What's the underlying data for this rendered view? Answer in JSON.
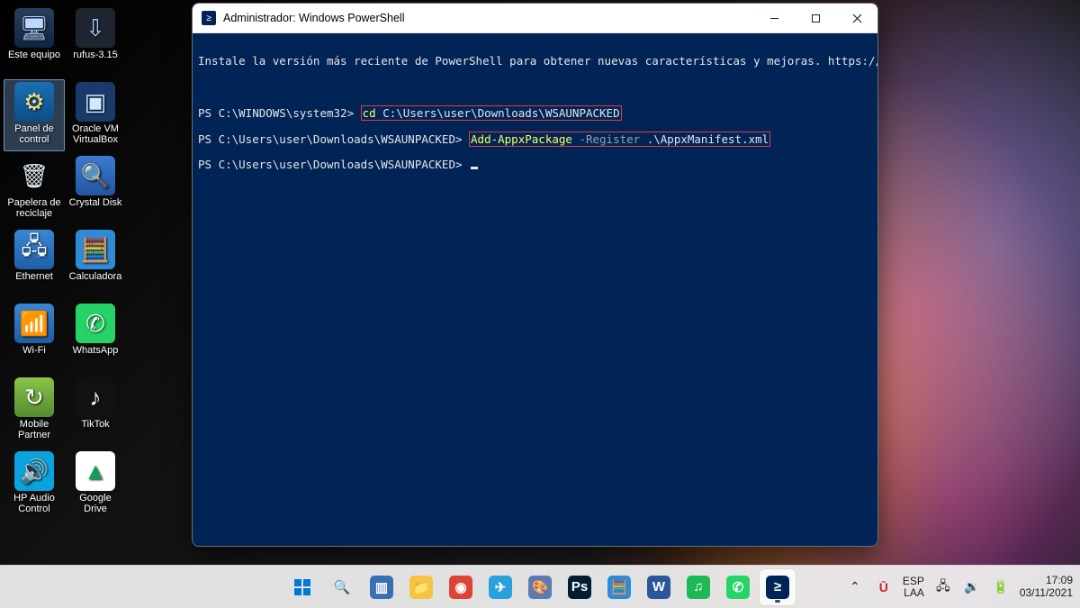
{
  "desktop": {
    "icons": [
      {
        "label": "Este equipo",
        "glyph": "🖥",
        "cls": "g-monitor",
        "selected": false
      },
      {
        "label": "Panel de control",
        "glyph": "⚙",
        "cls": "g-control",
        "selected": true
      },
      {
        "label": "Papelera de reciclaje",
        "glyph": "🗑",
        "cls": "g-recycle",
        "selected": false
      },
      {
        "label": "Ethernet",
        "glyph": "🖧",
        "cls": "g-net",
        "selected": false
      },
      {
        "label": "Wi-Fi",
        "glyph": "📶",
        "cls": "g-wifi",
        "selected": false
      },
      {
        "label": "Mobile Partner",
        "glyph": "↻",
        "cls": "g-mobile",
        "selected": false
      },
      {
        "label": "HP Audio Control",
        "glyph": "🔊",
        "cls": "g-audio",
        "selected": false
      },
      {
        "label": "rufus-3.15",
        "glyph": "⇩",
        "cls": "g-usb",
        "selected": false
      },
      {
        "label": "Oracle VM VirtualBox",
        "glyph": "▣",
        "cls": "g-vbox",
        "selected": false
      },
      {
        "label": "Crystal Disk",
        "glyph": "🔍",
        "cls": "g-crystal",
        "selected": false
      },
      {
        "label": "Calculadora",
        "glyph": "🧮",
        "cls": "g-calc",
        "selected": false
      },
      {
        "label": "WhatsApp",
        "glyph": "✆",
        "cls": "g-whatsapp",
        "selected": false
      },
      {
        "label": "TikTok",
        "glyph": "♪",
        "cls": "g-tiktok",
        "selected": false
      },
      {
        "label": "Google Drive",
        "glyph": "▲",
        "cls": "g-gdrive",
        "selected": false
      }
    ]
  },
  "window": {
    "title": "Administrador: Windows PowerShell",
    "banner": "Instale la versión más reciente de PowerShell para obtener nuevas características y mejoras. https://aka.ms/PSWindows",
    "lines": {
      "p1_prompt": "PS C:\\WINDOWS\\system32> ",
      "p1_cd": "cd",
      "p1_path": " C:\\Users\\user\\Downloads\\WSAUNPACKED",
      "p2_prompt": "PS C:\\Users\\user\\Downloads\\WSAUNPACKED> ",
      "p2_cmd": "Add-AppxPackage",
      "p2_flag": " -Register",
      "p2_arg": " .\\AppxManifest.xml",
      "p3_prompt": "PS C:\\Users\\user\\Downloads\\WSAUNPACKED> "
    }
  },
  "taskbar": {
    "apps": [
      {
        "name": "start",
        "glyph": "⊞",
        "color": "#0078d4",
        "active": false
      },
      {
        "name": "search",
        "glyph": "🔍",
        "color": "#333",
        "active": false
      },
      {
        "name": "task-view",
        "glyph": "▥",
        "color": "#3b6fb5",
        "active": false
      },
      {
        "name": "file-explorer",
        "glyph": "📁",
        "color": "#f5c542",
        "active": false
      },
      {
        "name": "chrome",
        "glyph": "◉",
        "color": "#db4437",
        "active": false
      },
      {
        "name": "telegram",
        "glyph": "✈",
        "color": "#2aa1da",
        "active": false
      },
      {
        "name": "paint",
        "glyph": "🎨",
        "color": "#5a7bb5",
        "active": false
      },
      {
        "name": "photoshop",
        "glyph": "Ps",
        "color": "#001d34",
        "active": false
      },
      {
        "name": "calculator",
        "glyph": "🧮",
        "color": "#2e8bd6",
        "active": false
      },
      {
        "name": "word",
        "glyph": "W",
        "color": "#2b579a",
        "active": false
      },
      {
        "name": "spotify",
        "glyph": "♫",
        "color": "#1db954",
        "active": false
      },
      {
        "name": "whatsapp",
        "glyph": "✆",
        "color": "#25d366",
        "active": false
      },
      {
        "name": "powershell",
        "glyph": "≥",
        "color": "#012456",
        "active": true
      }
    ],
    "tray": {
      "chevron": "⌃",
      "mcafee": "Ū",
      "lang_top": "ESP",
      "lang_bottom": "LAA",
      "network": "🖧",
      "volume": "🔉",
      "battery": "🔋",
      "time": "17:09",
      "date": "03/11/2021"
    }
  }
}
